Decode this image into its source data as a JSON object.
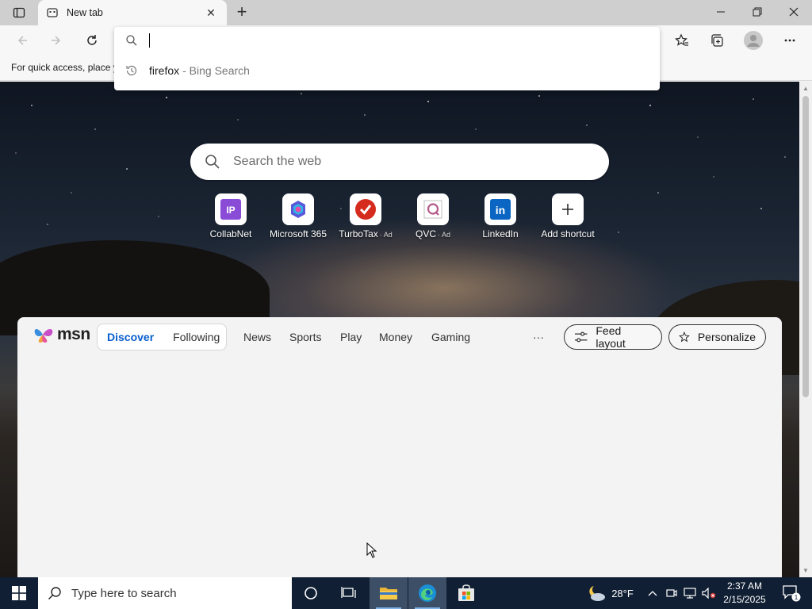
{
  "browser": {
    "tab_title": "New tab",
    "favorites_hint": "For quick access, place y"
  },
  "address_dropdown": {
    "input_value": "",
    "suggestion_query": "firefox",
    "suggestion_source": "- Bing Search"
  },
  "newtab": {
    "search_placeholder": "Search the web",
    "shortcuts": [
      {
        "label": "CollabNet",
        "ad": "",
        "icon": "collabnet-icon"
      },
      {
        "label": "Microsoft 365",
        "ad": "",
        "icon": "microsoft-365-icon"
      },
      {
        "label": "TurboTax",
        "ad": "· Ad",
        "icon": "turbotax-icon"
      },
      {
        "label": "QVC",
        "ad": "· Ad",
        "icon": "qvc-icon"
      },
      {
        "label": "LinkedIn",
        "ad": "",
        "icon": "linkedin-icon"
      },
      {
        "label": "Add shortcut",
        "ad": "",
        "icon": "plus-icon"
      }
    ]
  },
  "feed": {
    "logo_text": "msn",
    "pivots": [
      "Discover",
      "Following"
    ],
    "nav": [
      "News",
      "Sports",
      "Play",
      "Money",
      "Gaming"
    ],
    "more": "···",
    "feed_layout": "Feed layout",
    "personalize": "Personalize"
  },
  "taskbar": {
    "search_placeholder": "Type here to search",
    "weather": "28°F",
    "time": "2:37 AM",
    "date": "2/15/2025",
    "notifications": "1"
  },
  "colors": {
    "accent": "#0a5fcc",
    "taskbar": "#101f33",
    "collabnet": "#8a4bd6",
    "turbotax": "#d52b1e",
    "linkedin": "#0a66c2"
  }
}
